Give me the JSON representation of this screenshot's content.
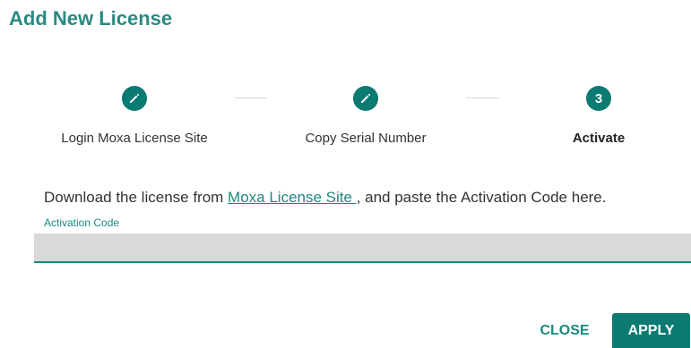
{
  "dialog": {
    "title": "Add New License"
  },
  "steps": [
    {
      "marker": "",
      "icon": "pencil-icon",
      "label": "Login Moxa License Site"
    },
    {
      "marker": "",
      "icon": "pencil-icon",
      "label": "Copy Serial Number"
    },
    {
      "marker": "3",
      "icon": "",
      "label": "Activate"
    }
  ],
  "instruction": {
    "before": "Download the license from ",
    "link": "Moxa License Site ",
    "after": ", and paste the Activation Code here."
  },
  "field": {
    "label": "Activation Code",
    "value": ""
  },
  "buttons": {
    "close": "CLOSE",
    "apply": "APPLY"
  },
  "colors": {
    "accent": "#0b7a72",
    "accent_text": "#1b8a80",
    "input_bg": "#d9d9d9"
  }
}
